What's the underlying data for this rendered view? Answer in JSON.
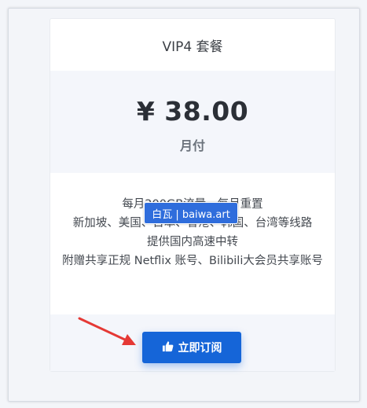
{
  "plan": {
    "title": "VIP4 套餐",
    "price": "¥ 38.00",
    "period": "月付",
    "features": [
      "每月200GB流量，每月重置",
      "新加坡、美国、日本、香港、韩国、台湾等线路",
      "提供国内高速中转",
      "附赠共享正规 Netflix 账号、Bilibili大会员共享账号"
    ],
    "cta": {
      "label": "立即订阅",
      "icon": "thumbs-up-icon",
      "color": "#1565d8"
    }
  },
  "watermark": {
    "text": "白瓦 | baiwa.art"
  },
  "annotation": {
    "arrow_color": "#e53935"
  }
}
